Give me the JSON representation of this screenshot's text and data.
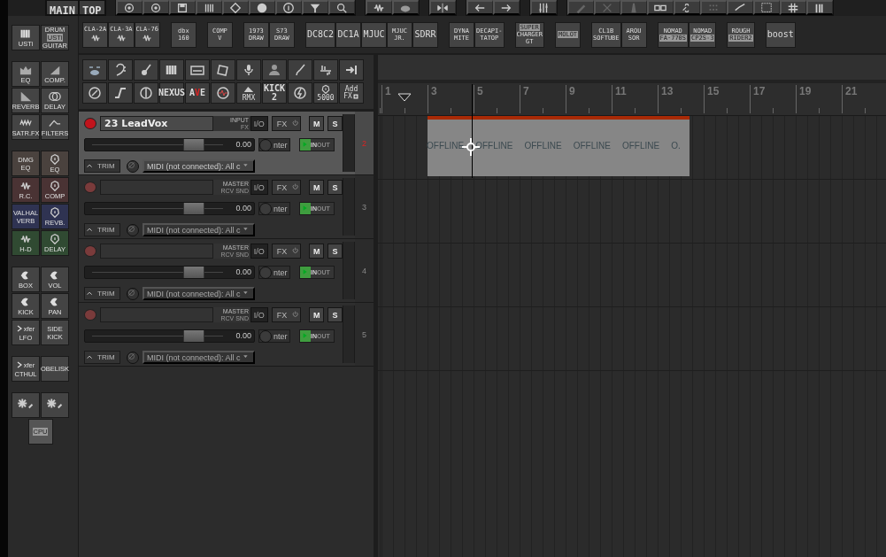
{
  "top_toolbar": {
    "tabs": [
      {
        "label": "MAIN"
      },
      {
        "label": "TOP"
      }
    ]
  },
  "plugin_bar": {
    "groups": [
      [
        {
          "kind": "wave",
          "lines": [
            "CLA-2A"
          ]
        },
        {
          "kind": "wave",
          "lines": [
            "CLA-3A"
          ]
        },
        {
          "kind": "wave",
          "lines": [
            "CLA-76"
          ]
        }
      ],
      [
        {
          "kind": "text",
          "lines": [
            "dbx",
            "160"
          ]
        }
      ],
      [
        {
          "kind": "text",
          "lines": [
            "COMP",
            "V"
          ]
        }
      ],
      [
        {
          "kind": "text",
          "lines": [
            "1973",
            "DRAW"
          ]
        },
        {
          "kind": "text",
          "lines": [
            "S73",
            "DRAW"
          ]
        }
      ],
      [
        {
          "kind": "text",
          "lines": [
            "DC8C2"
          ]
        },
        {
          "kind": "text",
          "lines": [
            "DC1A"
          ]
        },
        {
          "kind": "text",
          "lines": [
            "MJUC"
          ]
        },
        {
          "kind": "text",
          "lines": [
            "MJUC",
            "JR."
          ]
        },
        {
          "kind": "text",
          "lines": [
            "SDRR"
          ]
        }
      ],
      [
        {
          "kind": "text",
          "lines": [
            "DYNA",
            "MITE"
          ]
        },
        {
          "kind": "text",
          "lines": [
            "DECAPI-",
            "TATOP"
          ]
        }
      ],
      [
        {
          "kind": "boxed-first",
          "lines": [
            "SUPER",
            "CHARGER",
            "GT"
          ]
        }
      ],
      [
        {
          "kind": "boxed",
          "lines": [
            "MOLOT"
          ]
        }
      ],
      [
        {
          "kind": "text",
          "lines": [
            "CL1B",
            "SOFTUBE"
          ]
        },
        {
          "kind": "text",
          "lines": [
            "AROU",
            "SOR"
          ]
        }
      ],
      [
        {
          "kind": "boxed-last",
          "lines": [
            "NOMAD",
            "FA·770S"
          ]
        },
        {
          "kind": "boxed-last",
          "lines": [
            "NOMAD",
            "CP2S-3"
          ]
        }
      ],
      [
        {
          "kind": "boxed-last",
          "lines": [
            "ROUGH",
            "RIDER2"
          ]
        }
      ],
      [
        {
          "kind": "text",
          "lines": [
            "boost"
          ]
        }
      ]
    ]
  },
  "sidebar": {
    "groups": [
      [
        {
          "kind": "piano",
          "lines": [
            "USTi"
          ]
        },
        {
          "kind": "boxed-middle",
          "lines": [
            "DRUM",
            "USTi",
            "GUITAR"
          ]
        }
      ],
      [
        {
          "kind": "eq-bars",
          "lines": [
            "EQ"
          ]
        },
        {
          "kind": "ramp",
          "lines": [
            "COMP."
          ]
        },
        {
          "kind": "reverb",
          "lines": [
            "REVERB"
          ]
        },
        {
          "kind": "rings",
          "lines": [
            "DELAY"
          ]
        },
        {
          "kind": "zigzag",
          "lines": [
            "SATR.FX"
          ]
        },
        {
          "kind": "filter",
          "lines": [
            "FILTERS"
          ]
        }
      ],
      [
        {
          "kind": "text",
          "lines": [
            "DMG",
            "EQ"
          ],
          "color": "#4a423e"
        },
        {
          "kind": "knob",
          "lines": [
            "EQ"
          ],
          "color": "#4a423e"
        },
        {
          "kind": "wave",
          "lines": [
            "R.C."
          ],
          "color": "#4a3334"
        },
        {
          "kind": "knob",
          "lines": [
            "COMP"
          ],
          "color": "#4a3334"
        },
        {
          "kind": "text",
          "lines": [
            "VALHAL",
            "VERB"
          ],
          "color": "#2f3352"
        },
        {
          "kind": "knob",
          "lines": [
            "REVB."
          ],
          "color": "#2f3352"
        },
        {
          "kind": "wave",
          "lines": [
            "H-D"
          ],
          "color": "#304a32"
        },
        {
          "kind": "knob",
          "lines": [
            "DELAY"
          ],
          "color": "#304a32"
        }
      ],
      [
        {
          "kind": "pac",
          "lines": [
            "BOX"
          ]
        },
        {
          "kind": "pac",
          "lines": [
            "VOL"
          ]
        },
        {
          "kind": "pac",
          "lines": [
            "KICK"
          ]
        },
        {
          "kind": "pac",
          "lines": [
            "PAN"
          ]
        },
        {
          "kind": "xfer",
          "lines": [
            "xfer",
            "LFO"
          ]
        },
        {
          "kind": "text",
          "lines": [
            "SIDE",
            "KICK"
          ]
        }
      ],
      [
        {
          "kind": "xfer",
          "lines": [
            "xfer",
            "CTHUL"
          ]
        },
        {
          "kind": "text",
          "lines": [
            "OBELISK"
          ]
        }
      ],
      [
        {
          "kind": "burst"
        },
        {
          "kind": "burst"
        },
        {
          "kind": "cpu",
          "lines": [
            "CPU"
          ]
        }
      ]
    ]
  },
  "fx_toolbar": {
    "nexus": "NEXUS",
    "ave": "AVE",
    "rmx": "RMX",
    "kick": [
      "KICK",
      "2"
    ],
    "knob": "5000",
    "add": [
      "Add",
      "FX"
    ]
  },
  "tracks": [
    {
      "selected": true,
      "armed": true,
      "name": "23  LeadVox",
      "route": [
        "INPUT",
        "FX"
      ],
      "io": "I/O",
      "fx": "FX",
      "mute": "M",
      "solo": "S",
      "level": 0.64,
      "volume": "0.00",
      "pan": "nter",
      "input": "IN",
      "output": "OUT",
      "trim": "TRIM",
      "midi": "MIDI (not connected): All c",
      "number": "2"
    },
    {
      "selected": false,
      "armed": false,
      "route": [
        "MASTER",
        "RCV SND"
      ],
      "io": "I/O",
      "fx": "FX",
      "mute": "M",
      "solo": "S",
      "level": 0.64,
      "volume": "0.00",
      "pan": "nter",
      "input": "IN",
      "output": "OUT",
      "trim": "TRIM",
      "midi": "MIDI (not connected): All c",
      "number": "3"
    },
    {
      "selected": false,
      "armed": false,
      "route": [
        "MASTER",
        "RCV SND"
      ],
      "io": "I/O",
      "fx": "FX",
      "mute": "M",
      "solo": "S",
      "level": 0.64,
      "volume": "0.00",
      "pan": "nter",
      "input": "IN",
      "output": "OUT",
      "trim": "TRIM",
      "midi": "MIDI (not connected): All c",
      "number": "4"
    },
    {
      "selected": false,
      "armed": false,
      "route": [
        "MASTER",
        "RCV SND"
      ],
      "io": "I/O",
      "fx": "FX",
      "mute": "M",
      "solo": "S",
      "level": 0.64,
      "volume": "0.00",
      "pan": "nter",
      "input": "IN",
      "output": "OUT",
      "trim": "TRIM",
      "midi": "MIDI (not connected): All c",
      "number": "5"
    }
  ],
  "arrange": {
    "ruler": [
      "1",
      "3",
      "5",
      "7",
      "9",
      "11",
      "13",
      "15",
      "17",
      "19",
      "21"
    ],
    "item": {
      "labels": [
        "OFFLINE",
        "OFFLINE",
        "OFFLINE",
        "OFFLINE",
        "OFFLINE",
        "O."
      ]
    }
  }
}
